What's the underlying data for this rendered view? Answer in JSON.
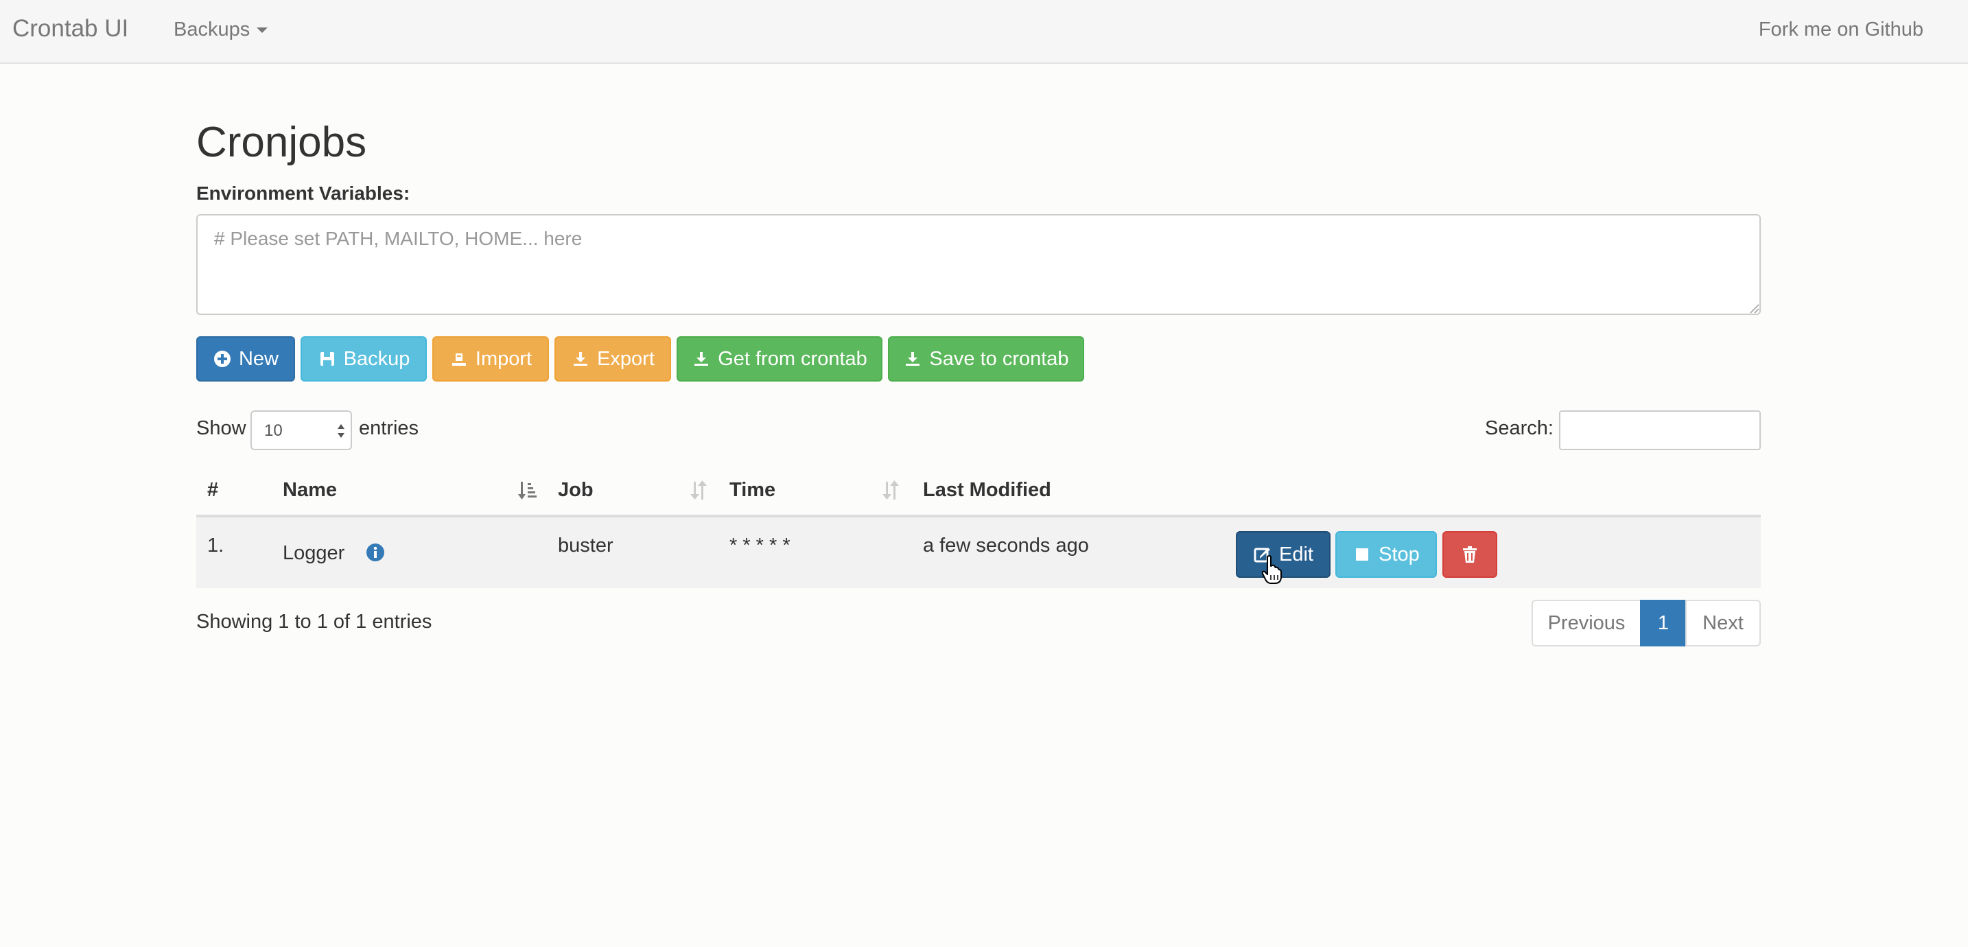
{
  "navbar": {
    "brand": "Crontab UI",
    "backups_menu": "Backups",
    "fork_link": "Fork me on Github"
  },
  "page": {
    "title": "Cronjobs",
    "env_label": "Environment Variables:",
    "env_placeholder": "# Please set PATH, MAILTO, HOME... here"
  },
  "toolbar": {
    "new": "New",
    "backup": "Backup",
    "import": "Import",
    "export": "Export",
    "get_from_crontab": "Get from crontab",
    "save_to_crontab": "Save to crontab"
  },
  "table_controls": {
    "show": "Show",
    "page_size": "10",
    "entries": "entries",
    "search_label": "Search:"
  },
  "table": {
    "columns": [
      "#",
      "Name",
      "Job",
      "Time",
      "Last Modified"
    ],
    "rows": [
      {
        "index": "1.",
        "name": "Logger",
        "job": "buster",
        "time": "* * * * *",
        "last_modified": "a few seconds ago",
        "actions": {
          "edit": "Edit",
          "stop": "Stop"
        }
      }
    ]
  },
  "footer": {
    "showing": "Showing 1 to 1 of 1 entries",
    "previous": "Previous",
    "current_page": "1",
    "next": "Next"
  },
  "colors": {
    "primary": "#337ab7",
    "info": "#5bc0de",
    "warning": "#f0ad4e",
    "success": "#5cb85c",
    "danger": "#d9534f",
    "edit_active": "#286090"
  }
}
